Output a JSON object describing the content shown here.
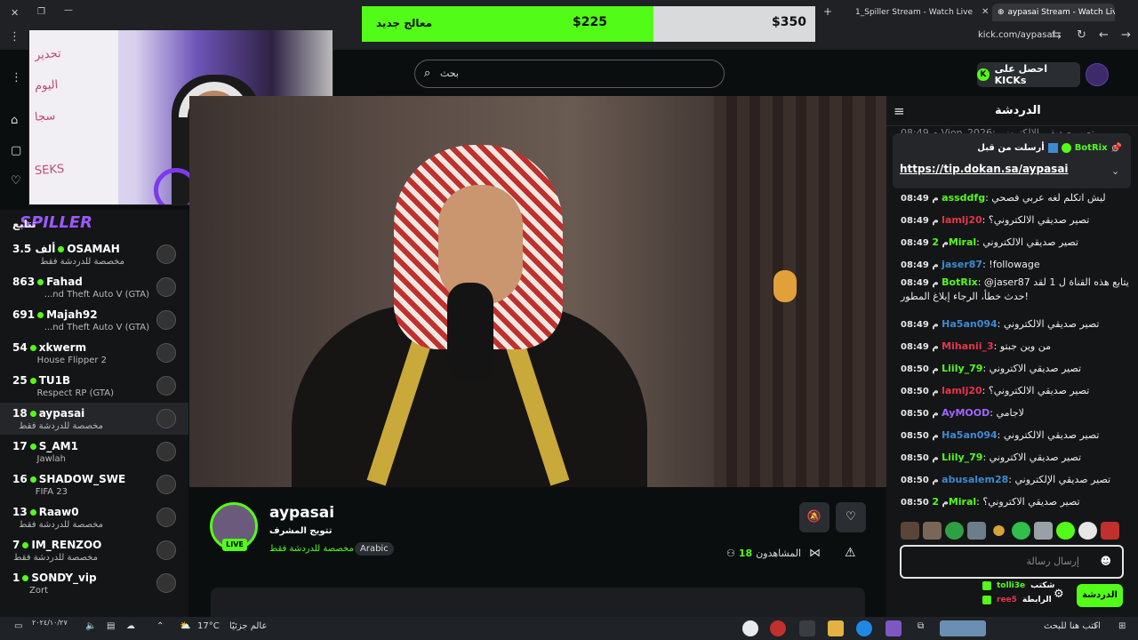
{
  "browser": {
    "tabs": [
      {
        "label": "1_Spiller Stream - Watch Live on",
        "active": false
      },
      {
        "label": "aypasai Stream - Watch Live",
        "active": true
      }
    ],
    "address": "kick.com/aypasai",
    "new_tab": "+"
  },
  "goal_bar": {
    "label": "معالج جديد",
    "current": "$225",
    "goal": "$350",
    "progress": 0.643
  },
  "search": {
    "placeholder": "بحث"
  },
  "header": {
    "kicks_label": "احصل على KICKs"
  },
  "sidebar": {
    "following_label": "تتابع",
    "overlay_text": "SPILLER",
    "channels": [
      {
        "count": "3.5 ألف",
        "name": "OSAMAH",
        "game": "مخصصة للدردشة فقط",
        "selected": false
      },
      {
        "count": "863",
        "name": "Fahad",
        "game": "...nd Theft Auto V (GTA)",
        "selected": false
      },
      {
        "count": "691",
        "name": "Majah92",
        "game": "...nd Theft Auto V (GTA)",
        "selected": false
      },
      {
        "count": "54",
        "name": "xkwerm",
        "game": "House Flipper 2",
        "selected": false
      },
      {
        "count": "25",
        "name": "TU1B",
        "game": "Respect RP (GTA)",
        "selected": false
      },
      {
        "count": "18",
        "name": "aypasai",
        "game": "مخصصة للدردشة فقط",
        "selected": true
      },
      {
        "count": "17",
        "name": "S_AM1",
        "game": "Jawlah",
        "selected": false
      },
      {
        "count": "16",
        "name": "SHADOW_SWE",
        "game": "FIFA 23",
        "selected": false
      },
      {
        "count": "13",
        "name": "Raaw0",
        "game": "مخصصة للدردشة فقط",
        "selected": false
      },
      {
        "count": "7",
        "name": "IM_RENZOO",
        "game": "مخصصة للدردشة فقط",
        "selected": false
      },
      {
        "count": "1",
        "name": "SONDY_vip",
        "game": "Zort",
        "selected": false
      }
    ]
  },
  "stream": {
    "name": "aypasai",
    "title": "تتويج المشرف",
    "category": "مخصصة للدردشة فقط",
    "tag": "Arabic",
    "live_label": "LIVE",
    "viewers_label": "المشاهدون",
    "viewers_count": "18"
  },
  "chat": {
    "title": "الدردشة",
    "pinned": {
      "by_label": "أرسلت من قبل",
      "bot_name": "BotRix",
      "link": "https://tip.dokan.sa/aypasai"
    },
    "messages": [
      {
        "time": "08:49 م",
        "user": "assddfg",
        "color": "#53fc18",
        "text": "ليش اتكلم لغه عربي فصحي"
      },
      {
        "time": "08:49 م",
        "user": "lamlj20",
        "color": "#e8344b",
        "text": "تصير صديقي الالكتروني؟"
      },
      {
        "time": "08:49 م",
        "user": "2Miral",
        "color": "#53fc18",
        "text": "تصير صديقي الالكتروني"
      },
      {
        "time": "08:49 م",
        "user": "jaser87",
        "color": "#3d8bd3",
        "text": "!followage"
      },
      {
        "time": "08:49 م",
        "user": "BotRix",
        "color": "#53fc18",
        "text": "@jaser87 يتابع هذه القناة ل 1 لقد حدث خطأ، الرجاء إبلاغ المطور!"
      },
      {
        "time": "08:49 م",
        "user": "Ha5an094",
        "color": "#3d8bd3",
        "text": "تصير صديقي الالكتروني"
      },
      {
        "time": "08:49 م",
        "user": "Mihanii_3",
        "color": "#e8344b",
        "text": "من وين جبتو"
      },
      {
        "time": "08:50 م",
        "user": "Liily_79",
        "color": "#53fc18",
        "text": "تصير صديقي الاكتروني"
      },
      {
        "time": "08:50 م",
        "user": "lamlj20",
        "color": "#e8344b",
        "text": "تصير صديقي الالكتروني؟"
      },
      {
        "time": "08:50 م",
        "user": "AyMOOD",
        "color": "#a066ff",
        "text": "لاجامي"
      },
      {
        "time": "08:50 م",
        "user": "Ha5an094",
        "color": "#3d8bd3",
        "text": "تصير صديقي الالكتروني"
      },
      {
        "time": "08:50 م",
        "user": "Liily_79",
        "color": "#53fc18",
        "text": "تصير صديقي الاكتروني"
      },
      {
        "time": "08:50 م",
        "user": "abusalem28",
        "color": "#3d8bd3",
        "text": "تصير صديقي الإلكتروني"
      },
      {
        "time": "08:50 م",
        "user": "2Miral",
        "color": "#53fc18",
        "text": "تصير صديقي الاكتروني؟"
      }
    ],
    "input_placeholder": "إرسال رسالة",
    "send_button": "الدردشة",
    "bot_items": [
      {
        "label": "شكتب",
        "name": "tolli3e"
      },
      {
        "label": "الرابطة",
        "name": "ree5"
      }
    ]
  },
  "taskbar": {
    "weather": "17°C",
    "weather_text": "عالم جزئيًا",
    "search_placeholder": "اكتب هنا للبحث",
    "date": "٢٠٢٤/١٠/٢٧"
  }
}
